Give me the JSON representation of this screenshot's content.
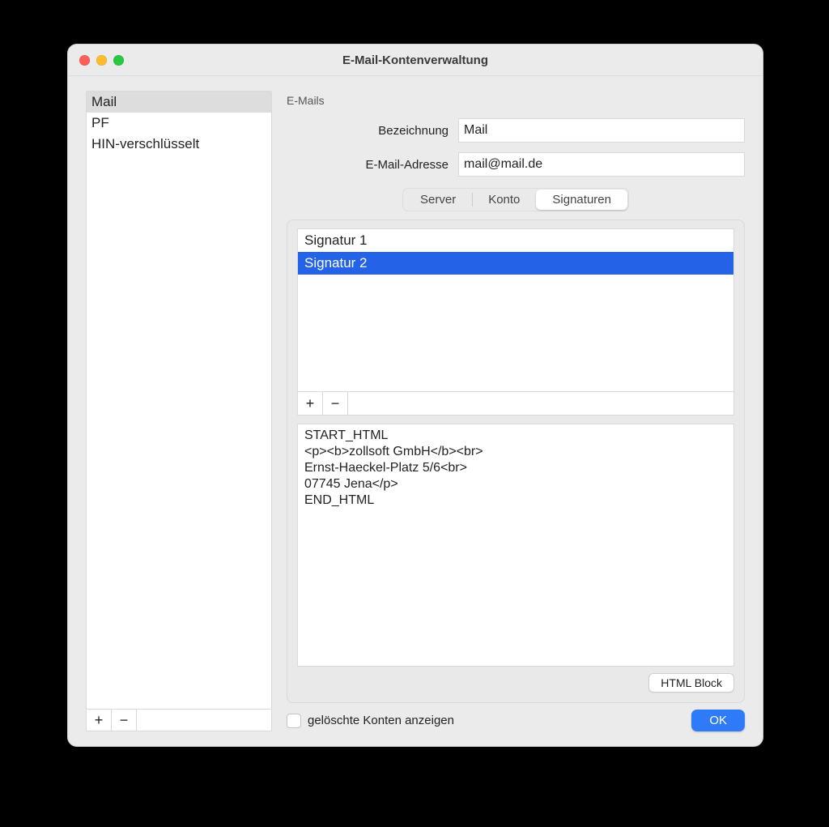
{
  "window": {
    "title": "E-Mail-Kontenverwaltung"
  },
  "sidebar": {
    "accounts": [
      {
        "name": "Mail",
        "selected": true
      },
      {
        "name": "PF",
        "selected": false
      },
      {
        "name": "HIN-verschlüsselt",
        "selected": false
      }
    ],
    "add_icon": "+",
    "remove_icon": "−"
  },
  "section_label": "E-Mails",
  "form": {
    "bezeichnung_label": "Bezeichnung",
    "bezeichnung_value": "Mail",
    "email_label": "E-Mail-Adresse",
    "email_value": "mail@mail.de"
  },
  "tabs": {
    "server": "Server",
    "konto": "Konto",
    "signaturen": "Signaturen",
    "active": "signaturen"
  },
  "signatures": {
    "items": [
      {
        "name": "Signatur 1",
        "selected": false
      },
      {
        "name": "Signatur 2",
        "selected": true
      }
    ],
    "add_icon": "+",
    "remove_icon": "−",
    "editor_text": "START_HTML\n<p><b>zollsoft GmbH</b><br>\nErnst-Haeckel-Platz 5/6<br>\n07745 Jena</p>\nEND_HTML",
    "html_block_label": "HTML Block"
  },
  "bottom": {
    "show_deleted_label": "gelöschte Konten anzeigen",
    "show_deleted_checked": false,
    "ok_label": "OK"
  }
}
